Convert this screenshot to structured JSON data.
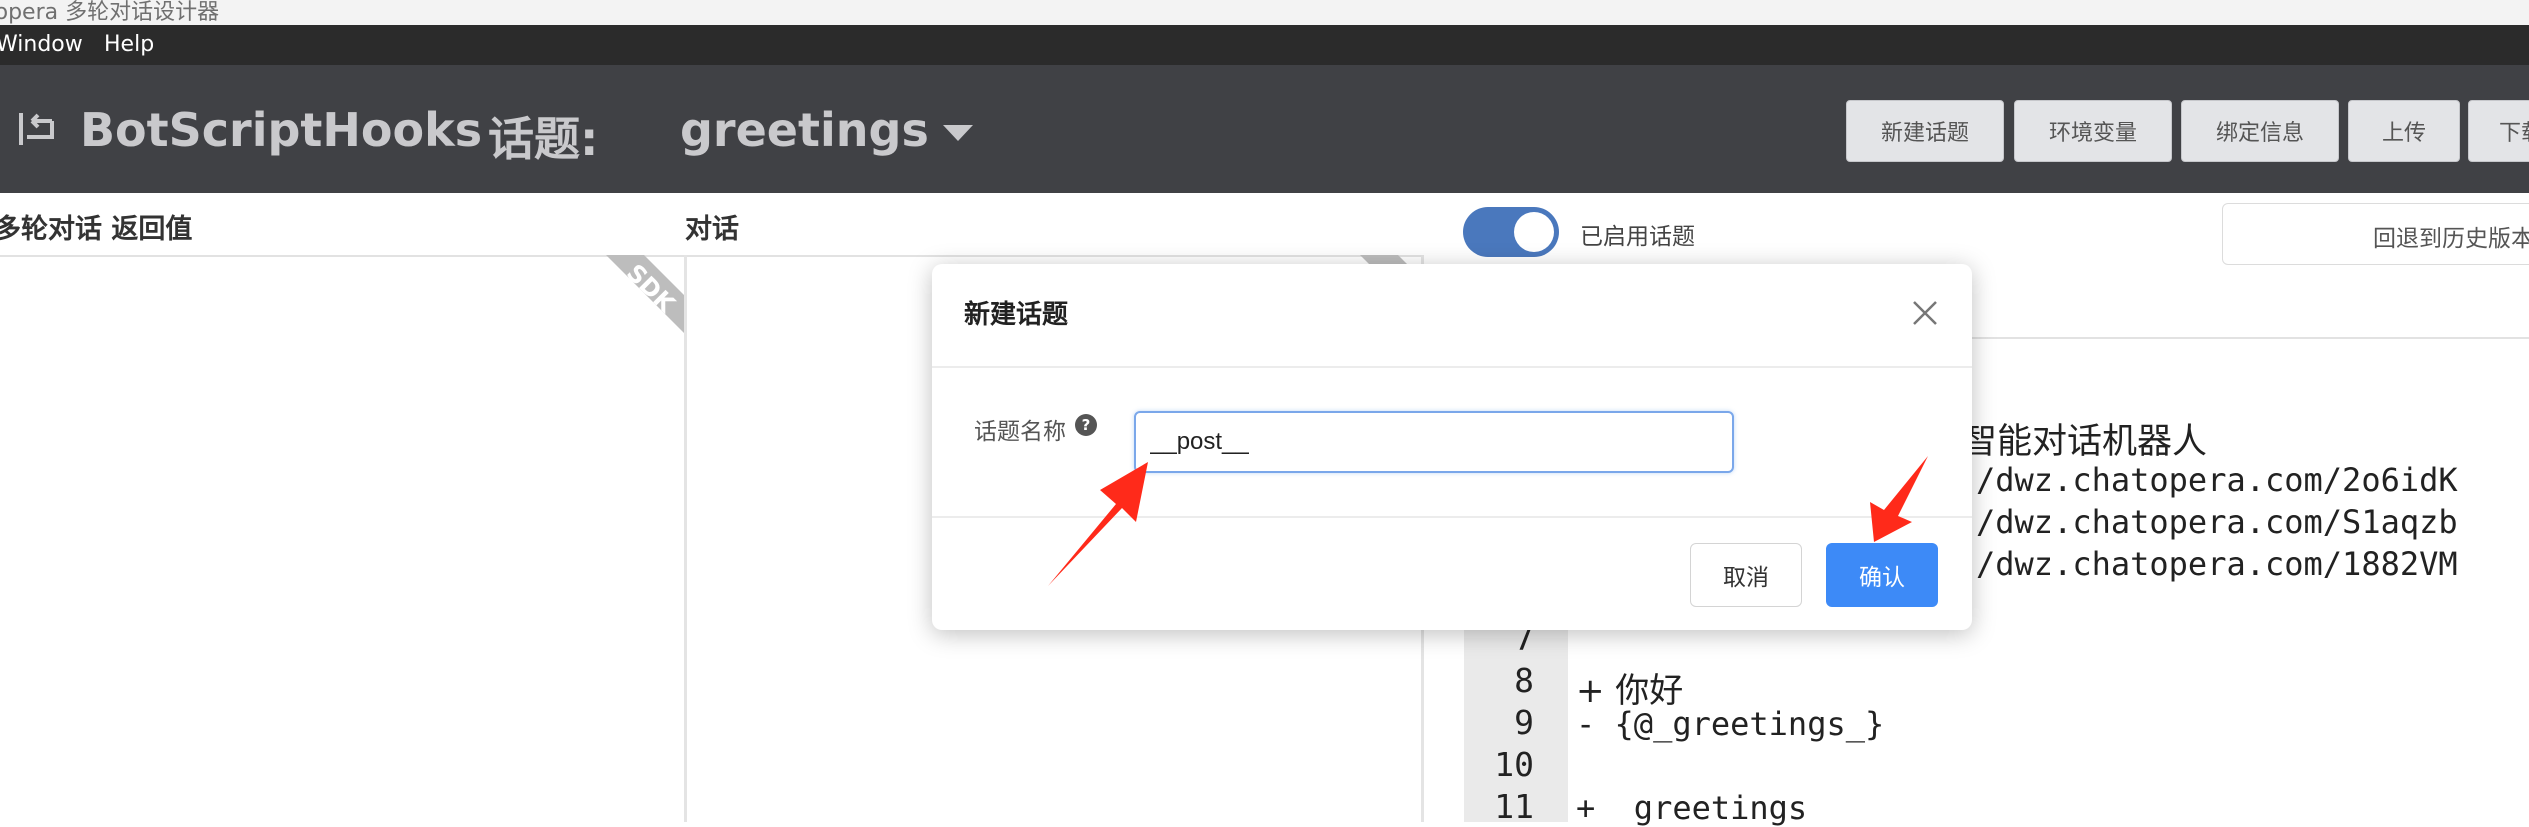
{
  "window": {
    "title": "topera 多轮对话设计器"
  },
  "menubar": {
    "items": [
      "Window",
      "Help"
    ]
  },
  "header": {
    "app_name": "BotScriptHooks",
    "topic_label": "话题:",
    "topic_value": "greetings",
    "buttons": [
      "新建话题",
      "环境变量",
      "绑定信息",
      "上传",
      "下载"
    ]
  },
  "columns": {
    "left_title": "多轮对话 返回值",
    "middle_title": "对话",
    "sdk_badge": "SDK"
  },
  "editor": {
    "toggle_label": "已启用话题",
    "toggle_on": true,
    "history_button": "回退到历史版本",
    "line_numbers": [
      "7",
      "8",
      "9",
      "10",
      "11"
    ],
    "partial_lines": [
      "智能对话机器人",
      "/dwz.chatopera.com/2o6idK",
      "/dwz.chatopera.com/S1aqzb",
      "/dwz.chatopera.com/1882VM"
    ],
    "code_lines": [
      "",
      "+ 你好",
      "- {@_greetings_}",
      "",
      "+  greetings"
    ]
  },
  "modal": {
    "title": "新建话题",
    "field_label": "话题名称",
    "input_value": "__post__",
    "cancel_label": "取消",
    "ok_label": "确认"
  },
  "colors": {
    "header_bg": "#404145",
    "menubar_bg": "#2b2b2b",
    "primary": "#3d8af7",
    "toggle": "#4a78bd",
    "annotation_arrow": "#ff2a1a"
  }
}
